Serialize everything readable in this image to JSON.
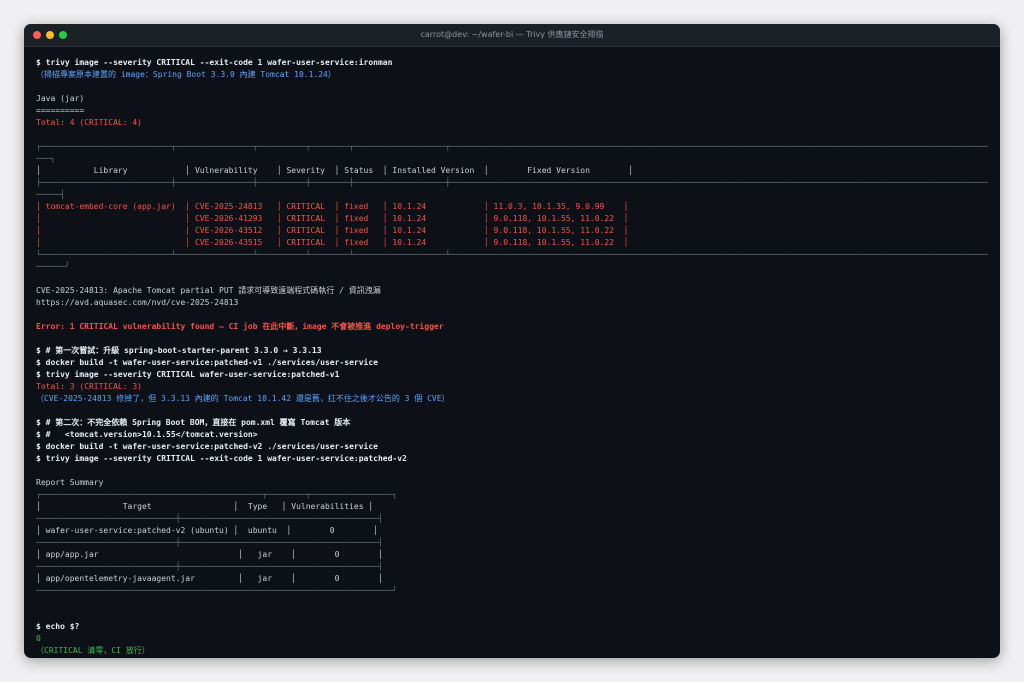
{
  "window": {
    "title": "carrot@dev: ~/wafer-bi — Trivy 供應鏈安全掃描"
  },
  "scan1": {
    "command": "$ trivy image --severity CRITICAL --exit-code 1 wafer-user-service:ironman",
    "note": "（掃描專案原本建置的 image：Spring Boot 3.3.0 內建 Tomcat 10.1.24）",
    "target": "Java (jar)",
    "underline": "==========",
    "total": "Total: 4 (CRITICAL: 4)"
  },
  "vuln_table": {
    "top": "┌───────────────────────────┬────────────────┬──────────┬────────┬───────────────────┬───────────────────────────────────────────────────────────────────────────────────────────────────────────────────────────────────────┐",
    "top_wrap": "───┐",
    "header": [
      "Library",
      "Vulnerability",
      "Severity",
      "Status",
      "Installed Version",
      "Fixed Version"
    ],
    "header_line": "│           Library            │ Vulnerability    │ Severity  │ Status  │ Installed Version  │        Fixed Version        │",
    "mid": "├───────────────────────────┼────────────────┼──────────┼────────┼───────────────────┼───────────────────────────────────────────────────────────────────────────────────────────────────────────────────────────────────────┤",
    "mid_wrap": "─────┤",
    "rows": [
      {
        "library": "tomcat-embed-core (app.jar)",
        "vuln": "CVE-2025-24813",
        "severity": "CRITICAL",
        "status": "fixed",
        "installed": "10.1.24",
        "fixed": "11.0.3, 10.1.35, 9.0.99"
      },
      {
        "library": "",
        "vuln": "CVE-2026-41293",
        "severity": "CRITICAL",
        "status": "fixed",
        "installed": "10.1.24",
        "fixed": "9.0.118, 10.1.55, 11.0.22"
      },
      {
        "library": "",
        "vuln": "CVE-2026-43512",
        "severity": "CRITICAL",
        "status": "fixed",
        "installed": "10.1.24",
        "fixed": "9.0.118, 10.1.55, 11.0.22"
      },
      {
        "library": "",
        "vuln": "CVE-2026-43515",
        "severity": "CRITICAL",
        "status": "fixed",
        "installed": "10.1.24",
        "fixed": "9.0.118, 10.1.55, 11.0.22"
      }
    ],
    "row_lines": [
      "│ tomcat-embed-core (app.jar)  │ CVE-2025-24813   │ CRITICAL  │ fixed   │ 10.1.24            │ 11.0.3, 10.1.35, 9.0.99    │",
      "│                              │ CVE-2026-41293   │ CRITICAL  │ fixed   │ 10.1.24            │ 9.0.118, 10.1.55, 11.0.22  │",
      "│                              │ CVE-2026-43512   │ CRITICAL  │ fixed   │ 10.1.24            │ 9.0.118, 10.1.55, 11.0.22  │",
      "│                              │ CVE-2026-43515   │ CRITICAL  │ fixed   │ 10.1.24            │ 9.0.118, 10.1.55, 11.0.22  │"
    ],
    "bottom": "└───────────────────────────┴────────────────┴──────────┴────────┴───────────────────┴───────────────────────────────────────────────────────────────────────────────────────────────────────────────────────────────────────┘",
    "bottom_wrap": "──────┘"
  },
  "cve_detail": {
    "line": "CVE-2025-24813: Apache Tomcat partial PUT 請求可導致遠端程式碼執行 / 資訊洩漏",
    "url": "https://avd.aquasec.com/nvd/cve-2025-24813"
  },
  "error_line": "Error: 1 CRITICAL vulnerability found — CI job 在此中斷，image 不會被推進 deploy-trigger",
  "attempt1": {
    "comment": "$ # 第一次嘗試：升級 spring-boot-starter-parent 3.3.0 → 3.3.13",
    "build": "$ docker build -t wafer-user-service:patched-v1 ./services/user-service",
    "scan": "$ trivy image --severity CRITICAL wafer-user-service:patched-v1",
    "total": "Total: 3 (CRITICAL: 3)",
    "note": "（CVE-2025-24813 修掉了，但 3.3.13 內建的 Tomcat 10.1.42 還是舊，扛不住之後才公告的 3 個 CVE）"
  },
  "attempt2": {
    "comment": "$ # 第二次：不完全依賴 Spring Boot BOM，直接在 pom.xml 覆寫 Tomcat 版本",
    "pom": "$ #   <tomcat.version>10.1.55</tomcat.version>",
    "build": "$ docker build -t wafer-user-service:patched-v2 ./services/user-service",
    "scan": "$ trivy image --severity CRITICAL --exit-code 1 wafer-user-service:patched-v2"
  },
  "report": {
    "title": "Report Summary",
    "top": "┌──────────────────────────────────────────────┬────────┬─────────────────┐",
    "top_wrap": "──────────────────────────────────────────────────────┐",
    "header": [
      "Target",
      "Type",
      "Vulnerabilities"
    ],
    "header_line": "│                 Target                 │  Type   │ Vulnerabilities │",
    "sep": "├──────────────────────────────────────────────┼────────┼─────────────────┤",
    "sep_wrap": "─────────────────────────────┼─────────────────────────────────────────┤",
    "rows": [
      {
        "target": "wafer-user-service:patched-v2 (ubuntu)",
        "type": "ubuntu",
        "vulns": "0"
      },
      {
        "target": "app/app.jar",
        "type": "jar",
        "vulns": "0"
      },
      {
        "target": "app/opentelemetry-javaagent.jar",
        "type": "jar",
        "vulns": "0"
      }
    ],
    "row_lines": [
      "│ wafer-user-service:patched-v2 (ubuntu) │  ubuntu  │        0        │",
      "│ app/app.jar                             │   jar    │        0        │",
      "│ app/opentelemetry-javaagent.jar         │   jar    │        0        │"
    ],
    "bottom": "└──────────────────────────────────────────────┴────────┴─────────────────┘",
    "bottom_wrap": "──────────────────────────────────────────────────────────────────────────┘"
  },
  "final": {
    "command": "$ echo $?",
    "exit_code": "0",
    "note": "（CRITICAL 清零，CI 放行）"
  },
  "colors": {
    "background": "#0d1117",
    "critical": "#f85149",
    "note": "#58a6ff",
    "success": "#3fb950"
  }
}
